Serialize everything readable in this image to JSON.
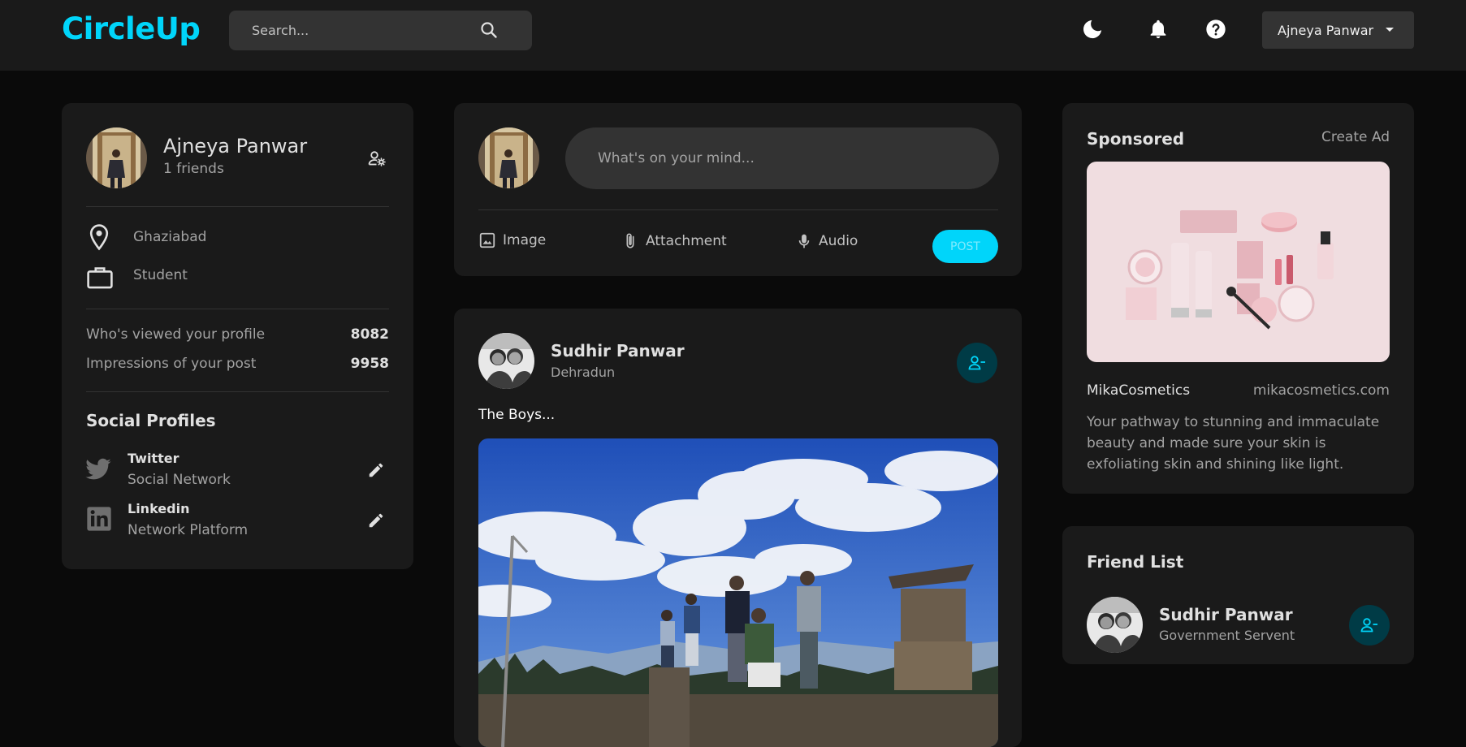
{
  "navbar": {
    "logo": "CircleUp",
    "search_placeholder": "Search...",
    "icons": [
      "moon-icon",
      "bell-icon",
      "help-icon"
    ],
    "user_select": "Ajneya Panwar"
  },
  "profile": {
    "name": "Ajneya Panwar",
    "friends": "1 friends",
    "location": "Ghaziabad",
    "occupation": "Student",
    "stats": [
      {
        "label": "Who's viewed your profile",
        "value": "8082"
      },
      {
        "label": "Impressions of your post",
        "value": "9958"
      }
    ],
    "social_title": "Social Profiles",
    "socials": [
      {
        "name": "Twitter",
        "type": "Social Network",
        "icon": "twitter-icon"
      },
      {
        "name": "Linkedin",
        "type": "Network Platform",
        "icon": "linkedin-icon"
      }
    ]
  },
  "composer": {
    "placeholder": "What's on your mind...",
    "actions": [
      "Image",
      "Attachment",
      "Audio"
    ],
    "post_label": "POST"
  },
  "post": {
    "author": "Sudhir Panwar",
    "location": "Dehradun",
    "caption": "The Boys..."
  },
  "sponsored": {
    "title": "Sponsored",
    "create_ad": "Create Ad",
    "brand": "MikaCosmetics",
    "url": "mikacosmetics.com",
    "description": "Your pathway to stunning and immaculate beauty and made sure your skin is exfoliating skin and shining like light."
  },
  "friends": {
    "title": "Friend List",
    "items": [
      {
        "name": "Sudhir Panwar",
        "subtitle": "Government Servent"
      }
    ]
  },
  "colors": {
    "accent": "#00d5fa",
    "card": "#1a1a1a",
    "background": "#0a0a0a",
    "input": "#333333",
    "friend_button": "#003b46"
  }
}
